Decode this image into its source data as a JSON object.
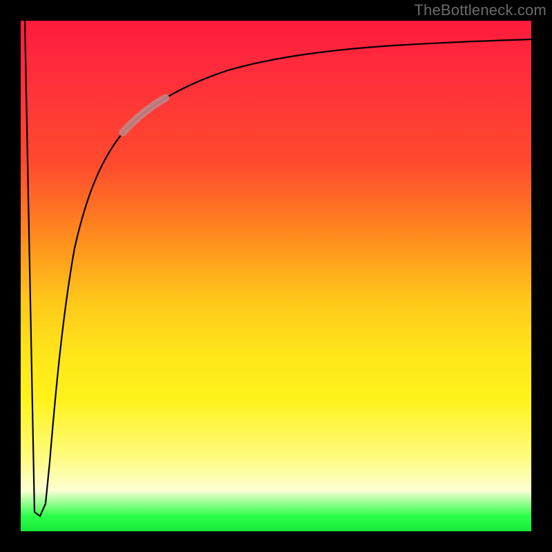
{
  "watermark": "TheBottleneck.com",
  "colors": {
    "frame": "#000000",
    "gradient_top": "#ff1a3c",
    "gradient_mid_orange": "#ff8a1e",
    "gradient_mid_yellow": "#ffe71a",
    "gradient_mid_pale": "#fdffd4",
    "gradient_bottom": "#17e83b",
    "curve": "#000000",
    "highlight": "#c38686",
    "watermark_text": "#6b6b6b"
  },
  "chart_data": {
    "type": "line",
    "title": "",
    "xlabel": "",
    "ylabel": "",
    "xlim": [
      0,
      100
    ],
    "ylim": [
      0,
      100
    ],
    "grid": false,
    "x": [
      0,
      1,
      2,
      3,
      3.5,
      4,
      5,
      6,
      8,
      10,
      12,
      15,
      20,
      25,
      30,
      40,
      50,
      60,
      80,
      100
    ],
    "series": [
      {
        "name": "bottleneck-curve",
        "values": [
          100,
          50,
          5,
          3,
          2,
          4,
          20,
          35,
          55,
          65,
          72,
          77,
          82,
          85.5,
          88,
          91,
          92.5,
          93.5,
          94.7,
          95.5
        ]
      }
    ],
    "annotations": [
      {
        "type": "highlight_segment",
        "x_start": 20,
        "x_end": 27,
        "note": "emphasized arc segment"
      }
    ]
  }
}
